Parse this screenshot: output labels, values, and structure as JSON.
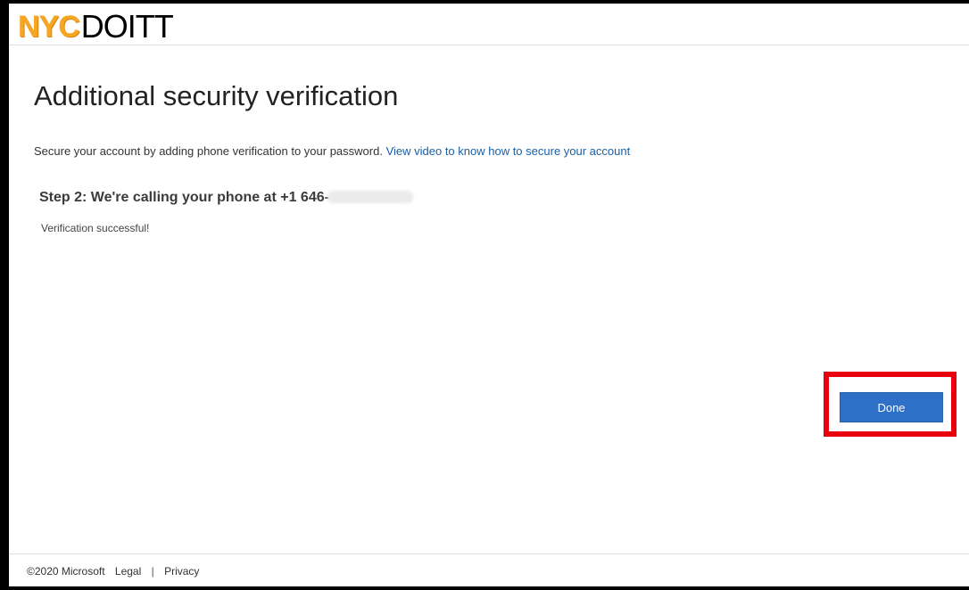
{
  "header": {
    "logo_nyc": "NYC",
    "logo_doitt": "DOITT"
  },
  "page": {
    "title": "Additional security verification",
    "intro_text": "Secure your account by adding phone verification to your password.",
    "intro_link": "View video to know how to secure your account",
    "step_text": "Step 2: We're calling your phone at +1 646-",
    "status_text": "Verification successful!"
  },
  "actions": {
    "done_label": "Done"
  },
  "footer": {
    "copyright": "©2020 Microsoft",
    "legal": "Legal",
    "separator": "|",
    "privacy": "Privacy"
  },
  "colors": {
    "link": "#1a5fa8",
    "primary_button": "#2e6fc7",
    "highlight_box": "#e8000f",
    "logo_orange": "#f5a623"
  }
}
